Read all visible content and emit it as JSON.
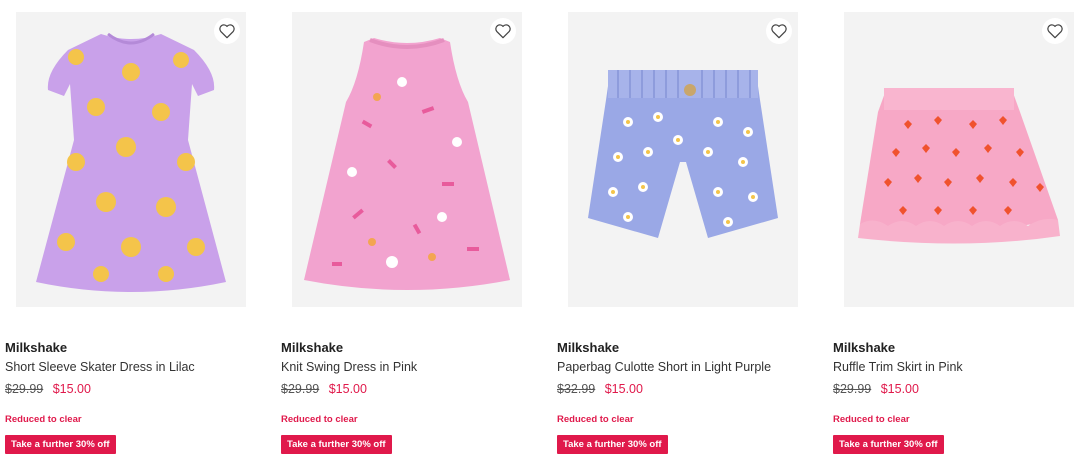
{
  "products": [
    {
      "brand": "Milkshake",
      "title": "Short Sleeve Skater Dress in Lilac",
      "was_price": "$29.99",
      "now_price": "$15.00",
      "status": "Reduced to clear",
      "promo": "Take a further 30% off",
      "colors": {
        "garment": "#c9a1ea",
        "pattern": "#f4c44a"
      }
    },
    {
      "brand": "Milkshake",
      "title": "Knit Swing Dress in Pink",
      "was_price": "$29.99",
      "now_price": "$15.00",
      "status": "Reduced to clear",
      "promo": "Take a further 30% off",
      "colors": {
        "garment": "#f2a3cf",
        "pattern": "#e85b9c"
      }
    },
    {
      "brand": "Milkshake",
      "title": "Paperbag Culotte Short in Light Purple",
      "was_price": "$32.99",
      "now_price": "$15.00",
      "status": "Reduced to clear",
      "promo": "Take a further 30% off",
      "colors": {
        "garment": "#9aa8e6",
        "pattern": "#ffffff"
      }
    },
    {
      "brand": "Milkshake",
      "title": "Ruffle Trim Skirt in Pink",
      "was_price": "$29.99",
      "now_price": "$15.00",
      "status": "Reduced to clear",
      "promo": "Take a further 30% off",
      "colors": {
        "garment": "#f7a8c6",
        "pattern": "#f0522e"
      }
    }
  ],
  "icons": {
    "wishlist": "heart-outline-icon"
  },
  "accent_color": "#e0194b"
}
